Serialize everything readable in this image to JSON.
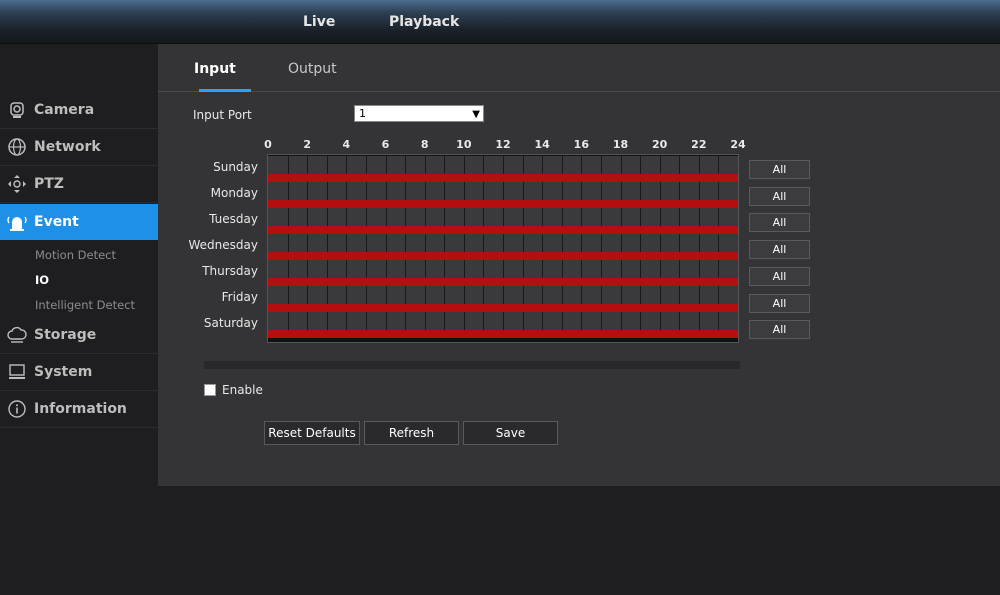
{
  "topnav": {
    "live": "Live",
    "playback": "Playback"
  },
  "sidebar": {
    "items": [
      {
        "label": "Camera",
        "icon": "camera-icon"
      },
      {
        "label": "Network",
        "icon": "network-icon"
      },
      {
        "label": "PTZ",
        "icon": "ptz-icon"
      },
      {
        "label": "Event",
        "icon": "alarm-icon"
      },
      {
        "label": "Storage",
        "icon": "storage-icon"
      },
      {
        "label": "System",
        "icon": "system-icon"
      },
      {
        "label": "Information",
        "icon": "info-icon"
      }
    ],
    "active": "Event",
    "event_subitems": [
      "Motion Detect",
      "IO",
      "Intelligent Detect"
    ],
    "active_subitem": "IO"
  },
  "tabs": [
    "Input",
    "Output"
  ],
  "active_tab": "Input",
  "form": {
    "input_port_label": "Input Port",
    "input_port_value": "1",
    "enable_label": "Enable",
    "enable_checked": false
  },
  "schedule": {
    "ticks": [
      "0",
      "2",
      "4",
      "6",
      "8",
      "10",
      "12",
      "14",
      "16",
      "18",
      "20",
      "22",
      "24"
    ],
    "days": [
      "Sunday",
      "Monday",
      "Tuesday",
      "Wednesday",
      "Thursday",
      "Friday",
      "Saturday"
    ],
    "all_label": "All",
    "scheduled_hours": [
      [
        0,
        24
      ],
      [
        0,
        24
      ],
      [
        0,
        24
      ],
      [
        0,
        24
      ],
      [
        0,
        24
      ],
      [
        0,
        24
      ],
      [
        0,
        24
      ]
    ]
  },
  "buttons": {
    "reset": "Reset Defaults",
    "refresh": "Refresh",
    "save": "Save"
  },
  "colors": {
    "accent": "#1e90e8",
    "schedule_bar": "#b30f0f",
    "tab_underline": "#2aa0ff"
  }
}
